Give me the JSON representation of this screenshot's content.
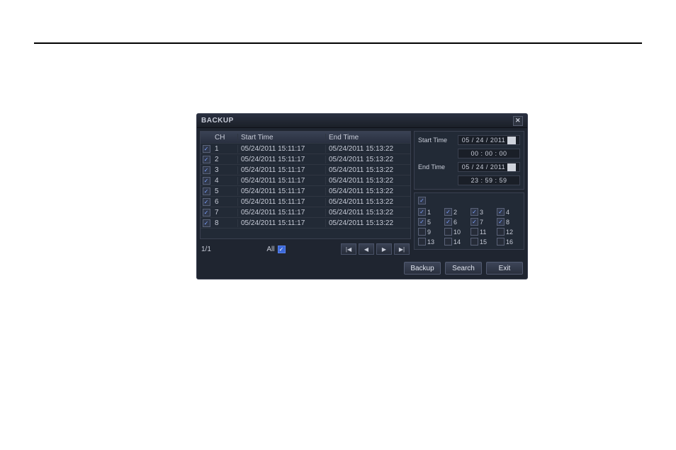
{
  "title": "BACKUP",
  "columns": {
    "ch": "CH",
    "start": "Start Time",
    "end": "End Time"
  },
  "rows": [
    {
      "checked": true,
      "ch": "1",
      "start": "05/24/2011 15:11:17",
      "end": "05/24/2011 15:13:22"
    },
    {
      "checked": true,
      "ch": "2",
      "start": "05/24/2011 15:11:17",
      "end": "05/24/2011 15:13:22"
    },
    {
      "checked": true,
      "ch": "3",
      "start": "05/24/2011 15:11:17",
      "end": "05/24/2011 15:13:22"
    },
    {
      "checked": true,
      "ch": "4",
      "start": "05/24/2011 15:11:17",
      "end": "05/24/2011 15:13:22"
    },
    {
      "checked": true,
      "ch": "5",
      "start": "05/24/2011 15:11:17",
      "end": "05/24/2011 15:13:22"
    },
    {
      "checked": true,
      "ch": "6",
      "start": "05/24/2011 15:11:17",
      "end": "05/24/2011 15:13:22"
    },
    {
      "checked": true,
      "ch": "7",
      "start": "05/24/2011 15:11:17",
      "end": "05/24/2011 15:13:22"
    },
    {
      "checked": true,
      "ch": "8",
      "start": "05/24/2011 15:11:17",
      "end": "05/24/2011 15:13:22"
    }
  ],
  "pager": {
    "page": "1/1",
    "all_label": "All"
  },
  "right": {
    "start_label": "Start Time",
    "start_date": "05 / 24 / 2011",
    "start_time": "00 : 00 : 00",
    "end_label": "End Time",
    "end_date": "05 / 24 / 2011",
    "end_time": "23 : 59 : 59"
  },
  "channels": [
    {
      "n": "1",
      "checked": true,
      "enabled": true
    },
    {
      "n": "2",
      "checked": true,
      "enabled": true
    },
    {
      "n": "3",
      "checked": true,
      "enabled": true
    },
    {
      "n": "4",
      "checked": true,
      "enabled": true
    },
    {
      "n": "5",
      "checked": true,
      "enabled": true
    },
    {
      "n": "6",
      "checked": true,
      "enabled": true
    },
    {
      "n": "7",
      "checked": true,
      "enabled": true
    },
    {
      "n": "8",
      "checked": true,
      "enabled": true
    },
    {
      "n": "9",
      "checked": false,
      "enabled": false
    },
    {
      "n": "10",
      "checked": false,
      "enabled": false
    },
    {
      "n": "11",
      "checked": false,
      "enabled": false
    },
    {
      "n": "12",
      "checked": false,
      "enabled": false
    },
    {
      "n": "13",
      "checked": false,
      "enabled": false
    },
    {
      "n": "14",
      "checked": false,
      "enabled": false
    },
    {
      "n": "15",
      "checked": false,
      "enabled": false
    },
    {
      "n": "16",
      "checked": false,
      "enabled": false
    }
  ],
  "all_channels_checked": true,
  "buttons": {
    "backup": "Backup",
    "search": "Search",
    "exit": "Exit"
  },
  "nav_icons": {
    "first": "|◀",
    "prev": "◀",
    "next": "▶",
    "last": "▶|"
  }
}
